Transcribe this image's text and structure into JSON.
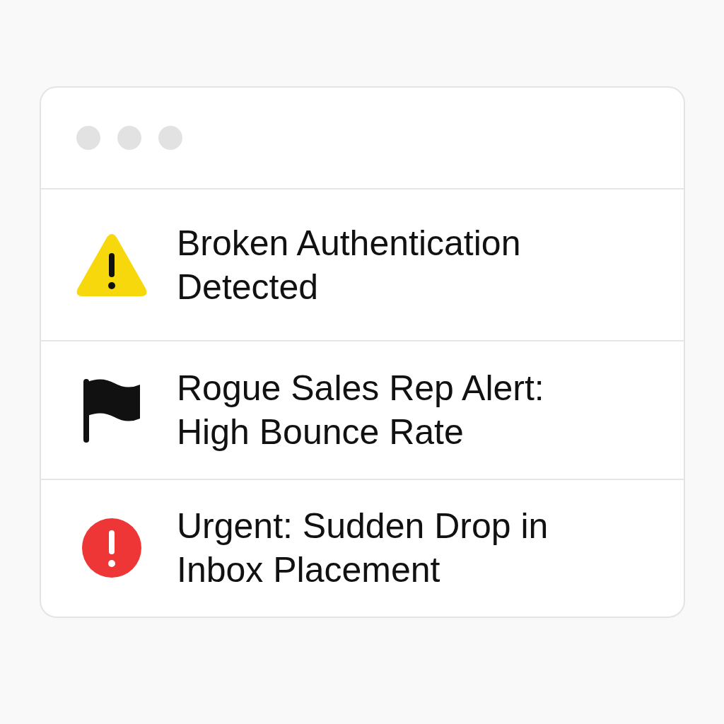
{
  "window": {
    "controls": [
      {
        "kind": "dot"
      },
      {
        "kind": "dot"
      },
      {
        "kind": "dot"
      }
    ]
  },
  "alerts": [
    {
      "kind": "warning",
      "title": "Broken Authentication Detected"
    },
    {
      "kind": "flag",
      "title": "Rogue Sales Rep Alert: High Bounce Rate"
    },
    {
      "kind": "error",
      "title": "Urgent: Sudden Drop in Inbox Placement"
    }
  ]
}
